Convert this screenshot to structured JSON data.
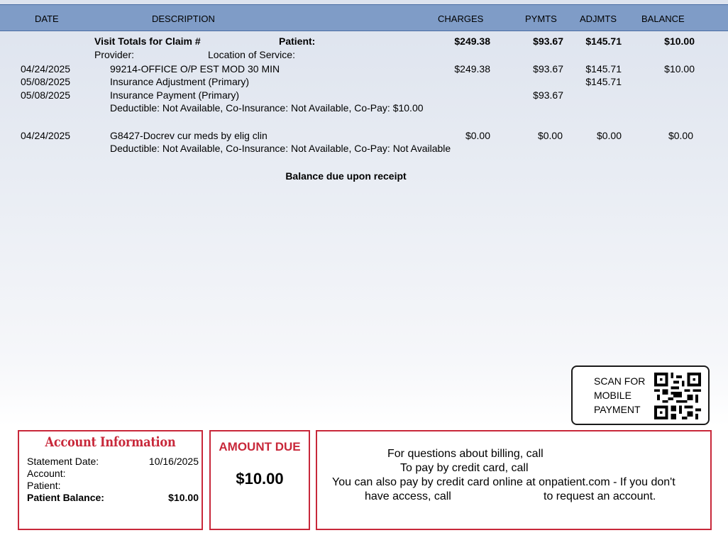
{
  "columns": {
    "date": "DATE",
    "description": "DESCRIPTION",
    "charges": "CHARGES",
    "pymts": "PYMTS",
    "adjmts": "ADJMTS",
    "balance": "BALANCE"
  },
  "visit_totals": {
    "claim_label": "Visit Totals for Claim #",
    "patient_label": "Patient:",
    "charges": "$249.38",
    "pymts": "$93.67",
    "adjmts": "$145.71",
    "balance": "$10.00",
    "provider_label": "Provider:",
    "location_label": "Location of Service:"
  },
  "lines": [
    {
      "date": "04/24/2025",
      "description": "99214-OFFICE O/P EST MOD 30 MIN",
      "charges": "$249.38",
      "pymts": "$93.67",
      "adjmts": "$145.71",
      "balance": "$10.00"
    },
    {
      "date": "05/08/2025",
      "description": "Insurance Adjustment (Primary)",
      "charges": "",
      "pymts": "",
      "adjmts": "$145.71",
      "balance": ""
    },
    {
      "date": "05/08/2025",
      "description": "Insurance Payment (Primary)",
      "charges": "",
      "pymts": "$93.67",
      "adjmts": "",
      "balance": ""
    },
    {
      "date": "",
      "description": "Deductible: Not Available, Co-Insurance: Not Available, Co-Pay: $10.00",
      "charges": "",
      "pymts": "",
      "adjmts": "",
      "balance": ""
    },
    {
      "date": "04/24/2025",
      "description": "G8427-Docrev cur meds by elig clin",
      "charges": "$0.00",
      "pymts": "$0.00",
      "adjmts": "$0.00",
      "balance": "$0.00"
    },
    {
      "date": "",
      "description": "Deductible: Not Available, Co-Insurance: Not Available, Co-Pay: Not Available",
      "charges": "",
      "pymts": "",
      "adjmts": "",
      "balance": ""
    }
  ],
  "balance_note": "Balance due upon receipt",
  "qr": {
    "line1": "SCAN FOR",
    "line2": "MOBILE",
    "line3": "PAYMENT",
    "icon": "qr-code-icon"
  },
  "account": {
    "title": "Account Information",
    "statement_date_label": "Statement Date:",
    "statement_date": "10/16/2025",
    "account_label": "Account:",
    "patient_label": "Patient:",
    "patient_balance_label": "Patient Balance:",
    "patient_balance": "$10.00"
  },
  "amount_due": {
    "title": "AMOUNT DUE",
    "value": "$10.00"
  },
  "message": {
    "line1": "For questions about billing, call",
    "line2": "To pay by credit card, call",
    "line3": "You can also pay by credit card online at onpatient.com - If you don't",
    "line4a": "have access, call",
    "line4b": "to request an account."
  },
  "colors": {
    "header": "#7f9cc7",
    "accent_red": "#c8283a"
  }
}
